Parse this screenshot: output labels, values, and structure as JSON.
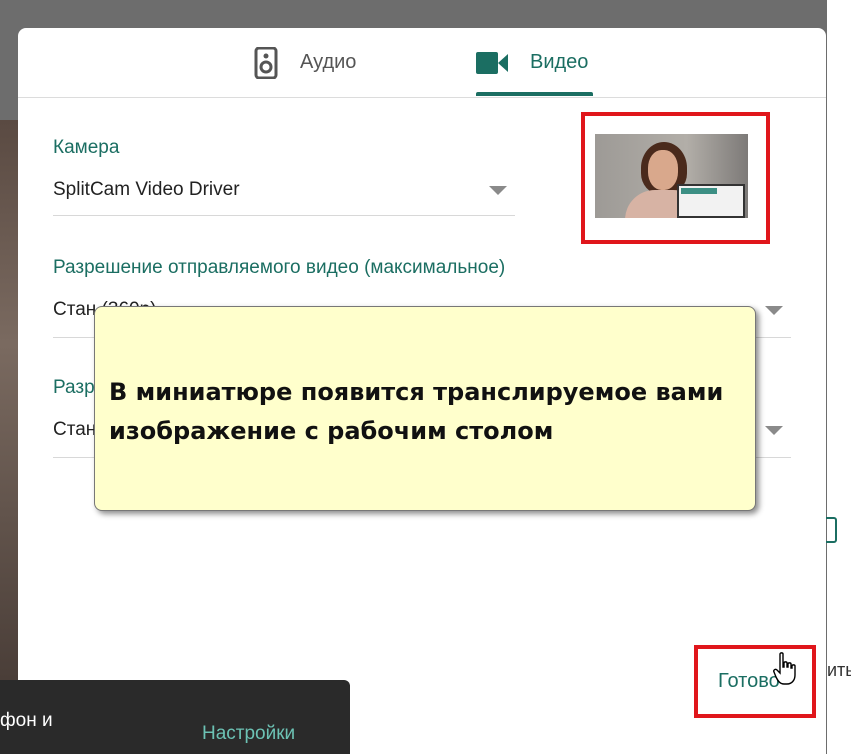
{
  "tabs": [
    {
      "label": "Аудио",
      "icon": "speaker-icon"
    },
    {
      "label": "Видео",
      "icon": "video-camera-icon"
    }
  ],
  "camera": {
    "label": "Камера",
    "value": "SplitCam Video Driver"
  },
  "send_resolution": {
    "label": "Разрешение отправляемого видео (максимальное)",
    "value": "Стан                                (360p)"
  },
  "receive_resolution": {
    "label": "Разр",
    "value": "Стан"
  },
  "done_label": "Готово",
  "callout": {
    "line1": "В миниатюре появится транслируемое вами",
    "line2": "изображение с рабочим столом"
  },
  "toast": {
    "text": "фон и",
    "settings_label": "Настройки"
  },
  "background": {
    "right_text": "ить"
  },
  "colors": {
    "accent": "#1b6e62",
    "highlight_frame": "#e0161b",
    "callout_bg": "#ffffcc"
  }
}
